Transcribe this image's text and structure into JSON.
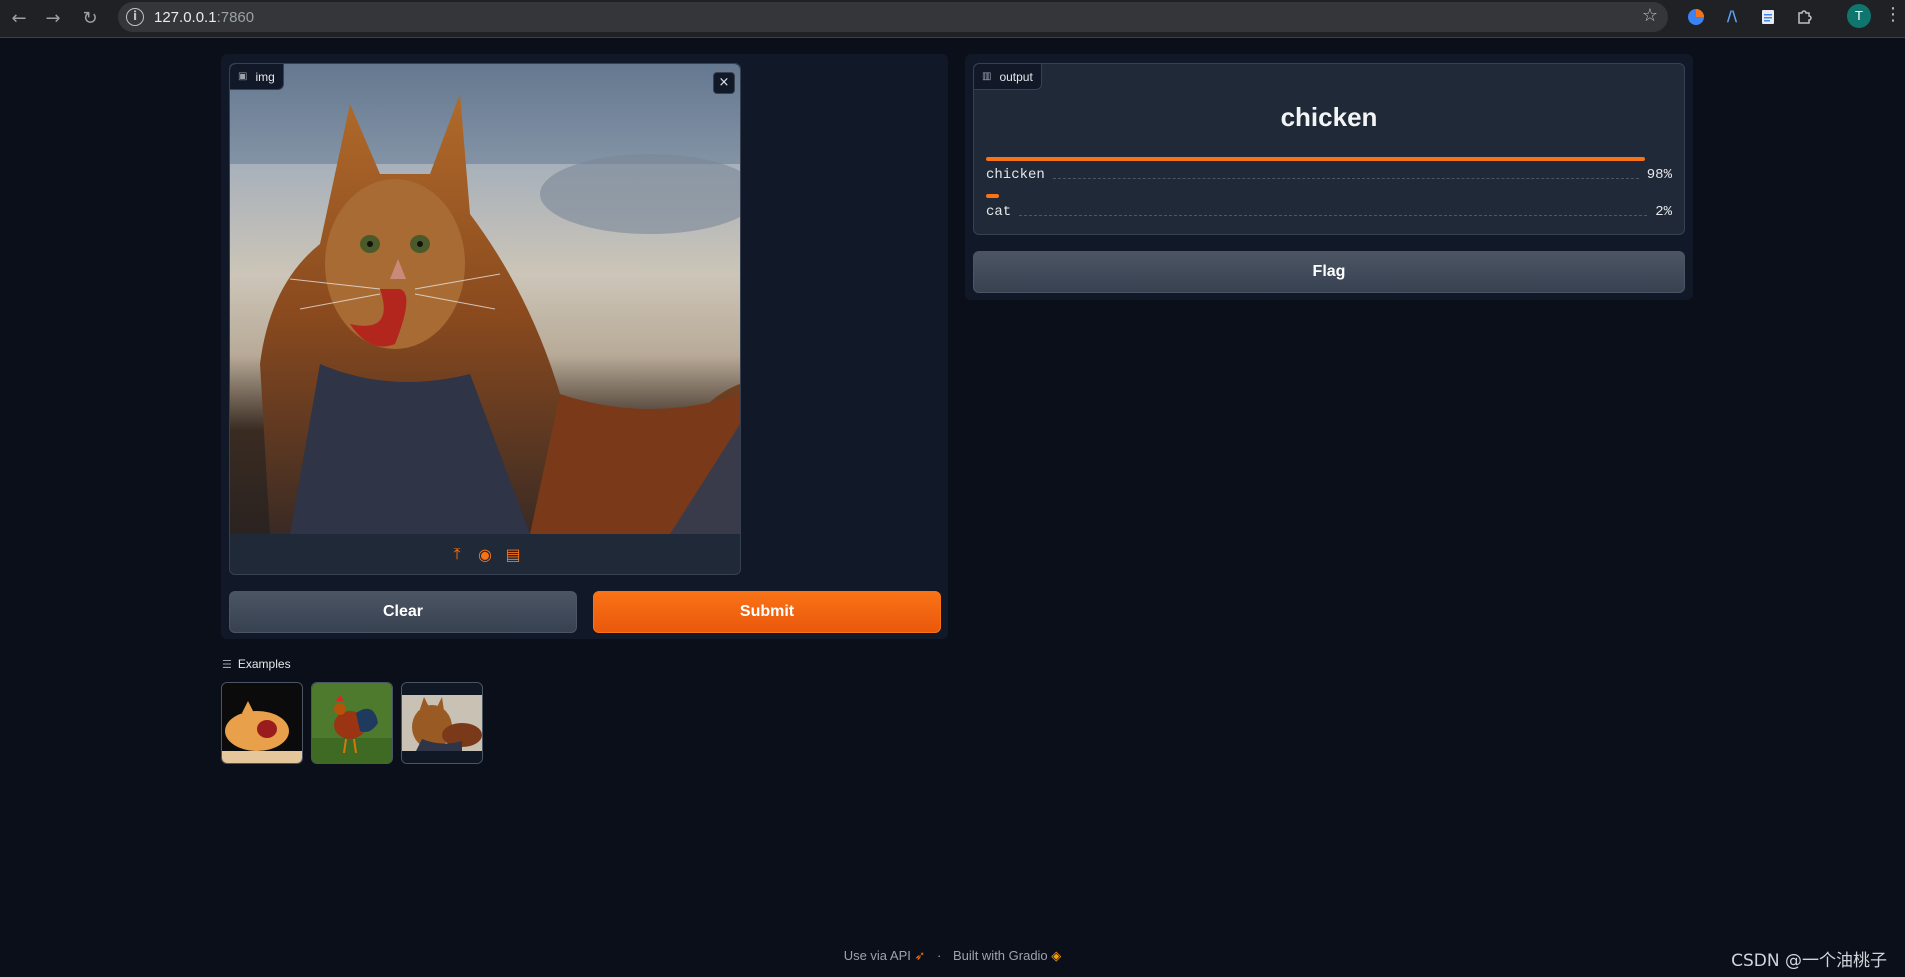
{
  "browser": {
    "url_host": "127.0.0.1",
    "url_port": ":7860",
    "profile_initial": "T"
  },
  "input": {
    "label": "img",
    "close_glyph": "×",
    "tools": [
      "upload-icon",
      "webcam-icon",
      "clipboard-icon"
    ]
  },
  "buttons": {
    "clear": "Clear",
    "submit": "Submit",
    "flag": "Flag"
  },
  "examples": {
    "label": "Examples",
    "items": [
      "cat-screaming",
      "rooster",
      "cat-chicken"
    ]
  },
  "output": {
    "label": "output",
    "top_label": "chicken",
    "confidences": [
      {
        "label": "chicken",
        "value": 98,
        "display": "98%"
      },
      {
        "label": "cat",
        "value": 2,
        "display": "2%"
      }
    ]
  },
  "footer": {
    "api": "Use via API",
    "sep": "·",
    "built": "Built with Gradio"
  },
  "watermark": "CSDN @一个油桃子",
  "colors": {
    "accent": "#f97316",
    "background": "#0b0f19",
    "panel": "#111827",
    "block": "#1f2937"
  }
}
